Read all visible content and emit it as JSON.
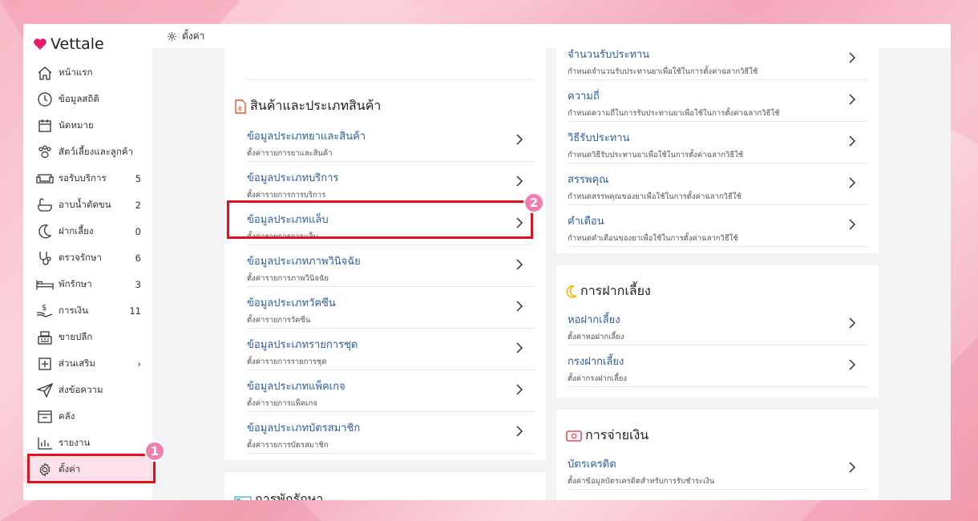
{
  "app": {
    "name": "Vettale",
    "brand_color": "#e8196b"
  },
  "topbar": {
    "title": "ตั้งค่า",
    "icon": "gear-icon"
  },
  "sidebar": {
    "items": [
      {
        "label": "หน้าแรก",
        "icon": "home-icon",
        "count": ""
      },
      {
        "label": "ข้อมูลสถิติ",
        "icon": "chart-clock-icon",
        "count": ""
      },
      {
        "label": "นัดหมาย",
        "icon": "calendar-icon",
        "count": ""
      },
      {
        "label": "สัตว์เลี้ยงและลูกค้า",
        "icon": "paw-icon",
        "count": ""
      },
      {
        "label": "รอรับบริการ",
        "icon": "sofa-icon",
        "count": "5"
      },
      {
        "label": "อาบน้ำตัดขน",
        "icon": "bathtub-icon",
        "count": "2"
      },
      {
        "label": "ฝากเลี้ยง",
        "icon": "moon-icon",
        "count": "0"
      },
      {
        "label": "ตรวจรักษา",
        "icon": "stethoscope-icon",
        "count": "6"
      },
      {
        "label": "พักรักษา",
        "icon": "bed-icon",
        "count": "3"
      },
      {
        "label": "การเงิน",
        "icon": "money-hand-icon",
        "count": "11"
      },
      {
        "label": "ขายปลีก",
        "icon": "cash-register-icon",
        "count": ""
      },
      {
        "label": "ส่วนเสริม",
        "icon": "plus-square-icon",
        "count": "›"
      },
      {
        "label": "ส่งข้อความ",
        "icon": "send-icon",
        "count": ""
      },
      {
        "label": "คลัง",
        "icon": "inventory-icon",
        "count": ""
      },
      {
        "label": "รายงาน",
        "icon": "bar-report-icon",
        "count": ""
      },
      {
        "label": "ตั้งค่า",
        "icon": "gear-icon",
        "count": ""
      }
    ]
  },
  "products_card": {
    "title": "สินค้าและประเภทสินค้า",
    "rows": [
      {
        "title": "ข้อมูลประเภทยาและสินค้า",
        "sub": "ตั้งค่ารายการยาและสินค้า"
      },
      {
        "title": "ข้อมูลประเภทบริการ",
        "sub": "ตั้งค่ารายการการบริการ"
      },
      {
        "title": "ข้อมูลประเภทแล็บ",
        "sub": "ตั้งค่ารายการการแล็บ"
      },
      {
        "title": "ข้อมูลประเภทภาพวินิจฉัย",
        "sub": "ตั้งค่ารายการภาพวินิจฉัย"
      },
      {
        "title": "ข้อมูลประเภทวัคซีน",
        "sub": "ตั้งค่ารายการวัคซีน"
      },
      {
        "title": "ข้อมูลประเภทรายการชุด",
        "sub": "ตั้งค่ารายการรายการชุด"
      },
      {
        "title": "ข้อมูลประเภทแพ็คเกจ",
        "sub": "ตั้งค่ารายการแพ็คเกจ"
      },
      {
        "title": "ข้อมูลประเภทบัตรสมาชิก",
        "sub": "ตั้งค่ารายการบัตรสมาชิก"
      }
    ]
  },
  "hospital_card": {
    "title": "การพักรักษา"
  },
  "drug_card": {
    "rows": [
      {
        "title": "จำนวนรับประทาน",
        "sub": "กำหนดจำนวนรับประทานยาเพื่อใช้ในการตั้งค่าฉลากวิธีใช้"
      },
      {
        "title": "ความถี่",
        "sub": "กำหนดความถี่ในการรับประทานยาเพื่อใช้ในการตั้งค่าฉลากวิธีใช้"
      },
      {
        "title": "วิธีรับประทาน",
        "sub": "กำหนดวิธีรับประทานยาเพื่อใช้ในการตั้งค่าฉลากวิธีใช้"
      },
      {
        "title": "สรรพคุณ",
        "sub": "กำหนดสรรพคุณของยาเพื่อใช้ในการตั้งค่าฉลากวิธีใช้"
      },
      {
        "title": "คำเตือน",
        "sub": "กำหนดคำเตือนของยาเพื่อใช้ในการตั้งค่าฉลากวิธีใช้"
      }
    ]
  },
  "boarding_card": {
    "title": "การฝากเลี้ยง",
    "rows": [
      {
        "title": "หอฝากเลี้ยง",
        "sub": "ตั้งค่าหอฝากเลี้ยง"
      },
      {
        "title": "กรงฝากเลี้ยง",
        "sub": "ตั้งค่ากรงฝากเลี้ยง"
      }
    ]
  },
  "payment_card": {
    "title": "การจ่ายเงิน",
    "rows": [
      {
        "title": "บัตรเครดิต",
        "sub": "ตั้งค่าข้อมูลบัตรเครดิตสำหรับการรับชำระเงิน"
      }
    ]
  },
  "annotations": {
    "step1": "1",
    "step2": "2"
  },
  "colors": {
    "link": "#2e5e9c",
    "highlight": "#e0101c",
    "badge": "#f07fb1",
    "active_bg": "#fde0ea"
  }
}
